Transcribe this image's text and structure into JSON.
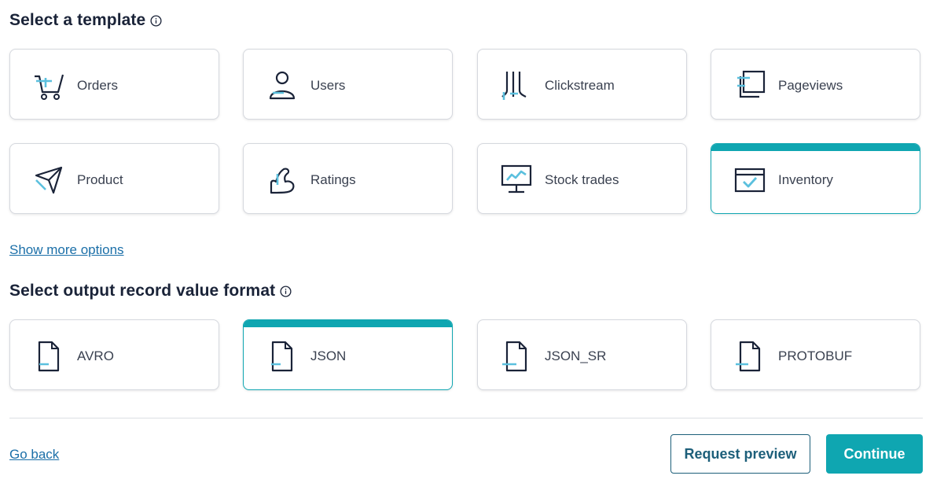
{
  "template_section": {
    "heading": "Select a template",
    "cards": [
      {
        "label": "Orders",
        "icon": "shopping-cart-icon",
        "selected": false
      },
      {
        "label": "Users",
        "icon": "user-icon",
        "selected": false
      },
      {
        "label": "Clickstream",
        "icon": "clickstream-icon",
        "selected": false
      },
      {
        "label": "Pageviews",
        "icon": "pageviews-icon",
        "selected": false
      },
      {
        "label": "Product",
        "icon": "send-arrow-icon",
        "selected": false
      },
      {
        "label": "Ratings",
        "icon": "flexed-arm-icon",
        "selected": false
      },
      {
        "label": "Stock trades",
        "icon": "monitor-chart-icon",
        "selected": false
      },
      {
        "label": "Inventory",
        "icon": "window-check-icon",
        "selected": true
      }
    ],
    "show_more": "Show more options"
  },
  "format_section": {
    "heading": "Select output record value format",
    "cards": [
      {
        "label": "AVRO",
        "icon": "document-icon",
        "selected": false
      },
      {
        "label": "JSON",
        "icon": "document-icon",
        "selected": true
      },
      {
        "label": "JSON_SR",
        "icon": "document-icon",
        "selected": false
      },
      {
        "label": "PROTOBUF",
        "icon": "document-icon",
        "selected": false
      }
    ]
  },
  "footer": {
    "go_back": "Go back",
    "request_preview": "Request preview",
    "continue": "Continue"
  },
  "colors": {
    "accent": "#0fa6b1",
    "icon_accent": "#5bc0de",
    "text_dark": "#1a2338",
    "link": "#1b6fa8"
  }
}
